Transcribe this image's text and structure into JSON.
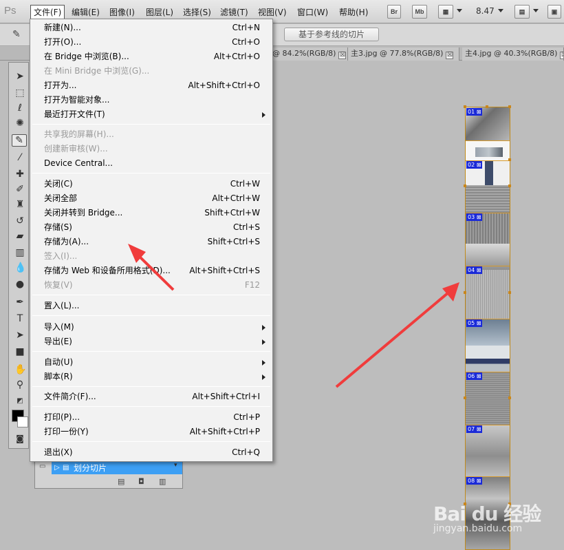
{
  "app": {
    "logo": "Ps",
    "menus": [
      "文件(F)",
      "编辑(E)",
      "图像(I)",
      "图层(L)",
      "选择(S)",
      "滤镜(T)",
      "视图(V)",
      "窗口(W)",
      "帮助(H)"
    ],
    "active_menu": "文件(F)",
    "menubar_buttons": [
      "Br",
      "Mb"
    ],
    "zoom": "8.47"
  },
  "options_bar": {
    "slice_button": "基于参考线的切片"
  },
  "doc_tabs": [
    {
      "label": "@ 84.2%(RGB/8)",
      "close": "☒"
    },
    {
      "label": "主3.jpg @ 77.8%(RGB/8)",
      "close": "☒"
    },
    {
      "label": "主4.jpg @ 40.3%(RGB/8)",
      "close": "☒"
    }
  ],
  "actions_panel": {
    "current_action": "划分切片"
  },
  "file_menu": {
    "groups": [
      [
        {
          "label": "新建(N)...",
          "shortcut": "Ctrl+N"
        },
        {
          "label": "打开(O)...",
          "shortcut": "Ctrl+O"
        },
        {
          "label": "在 Bridge 中浏览(B)...",
          "shortcut": "Alt+Ctrl+O"
        },
        {
          "label": "在 Mini Bridge 中浏览(G)...",
          "shortcut": "",
          "disabled": true
        },
        {
          "label": "打开为...",
          "shortcut": "Alt+Shift+Ctrl+O"
        },
        {
          "label": "打开为智能对象...",
          "shortcut": ""
        },
        {
          "label": "最近打开文件(T)",
          "shortcut": "",
          "submenu": true
        }
      ],
      [
        {
          "label": "共享我的屏幕(H)...",
          "shortcut": "",
          "disabled": true
        },
        {
          "label": "创建新审核(W)...",
          "shortcut": "",
          "disabled": true
        },
        {
          "label": "Device Central...",
          "shortcut": ""
        }
      ],
      [
        {
          "label": "关闭(C)",
          "shortcut": "Ctrl+W"
        },
        {
          "label": "关闭全部",
          "shortcut": "Alt+Ctrl+W"
        },
        {
          "label": "关闭并转到 Bridge...",
          "shortcut": "Shift+Ctrl+W"
        },
        {
          "label": "存储(S)",
          "shortcut": "Ctrl+S"
        },
        {
          "label": "存储为(A)...",
          "shortcut": "Shift+Ctrl+S"
        },
        {
          "label": "签入(I)...",
          "shortcut": "",
          "disabled": true
        },
        {
          "label": "存储为 Web 和设备所用格式(D)...",
          "shortcut": "Alt+Shift+Ctrl+S"
        },
        {
          "label": "恢复(V)",
          "shortcut": "F12",
          "disabled": true
        }
      ],
      [
        {
          "label": "置入(L)...",
          "shortcut": ""
        }
      ],
      [
        {
          "label": "导入(M)",
          "shortcut": "",
          "submenu": true
        },
        {
          "label": "导出(E)",
          "shortcut": "",
          "submenu": true
        }
      ],
      [
        {
          "label": "自动(U)",
          "shortcut": "",
          "submenu": true
        },
        {
          "label": "脚本(R)",
          "shortcut": "",
          "submenu": true
        }
      ],
      [
        {
          "label": "文件简介(F)...",
          "shortcut": "Alt+Shift+Ctrl+I"
        }
      ],
      [
        {
          "label": "打印(P)...",
          "shortcut": "Ctrl+P"
        },
        {
          "label": "打印一份(Y)",
          "shortcut": "Alt+Shift+Ctrl+P"
        }
      ],
      [
        {
          "label": "退出(X)",
          "shortcut": "Ctrl+Q"
        }
      ]
    ]
  },
  "canvas": {
    "slices": [
      "01",
      "02",
      "03",
      "04",
      "05",
      "06",
      "07",
      "08"
    ]
  },
  "watermark": {
    "logo": "Bai du 经验",
    "url": "jingyan.baidu.com"
  },
  "colors": {
    "annotation_arrow": "#f03c3c",
    "slice_badge": "#1a2ad8",
    "slice_line": "#d89a2a",
    "menu_bg": "#f2f2f2"
  }
}
